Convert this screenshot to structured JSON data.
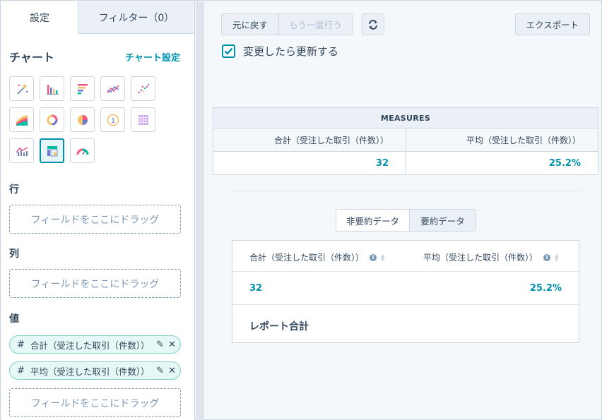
{
  "tabs": {
    "settings": "設定",
    "filters": "フィルター（0）"
  },
  "chart_section": {
    "title": "チャート",
    "settings_link": "チャート設定"
  },
  "chart_types": [
    "magic-wand-icon",
    "vertical-bar-chart-icon",
    "horizontal-bar-chart-icon",
    "line-chart-icon",
    "scatter-chart-icon",
    "area-chart-icon",
    "donut-chart-icon",
    "pie-chart-icon",
    "kpi-number-icon",
    "table-grid-icon",
    "combo-chart-icon",
    "pivot-table-icon",
    "gauge-chart-icon"
  ],
  "rows": {
    "label": "行",
    "dropzone": "フィールドをここにドラッグ"
  },
  "columns": {
    "label": "列",
    "dropzone": "フィールドをここにドラッグ"
  },
  "values": {
    "label": "値",
    "pills": [
      {
        "text": "合計（受注した取引（件数））"
      },
      {
        "text": "平均（受注した取引（件数））"
      }
    ],
    "dropzone": "フィールドをここにドラッグ"
  },
  "toolbar": {
    "undo": "元に戻す",
    "redo": "もう一度行う",
    "export": "エクスポート"
  },
  "auto_refresh": {
    "label": "変更したら更新する",
    "checked": true
  },
  "measures_table": {
    "header": "MEASURES",
    "columns": [
      "合計（受注した取引（件数））",
      "平均（受注した取引（件数））"
    ],
    "values": [
      "32",
      "25.2%"
    ]
  },
  "data_toggle": {
    "unsummarized": "非要約データ",
    "summarized": "要約データ"
  },
  "summary_table": {
    "columns": [
      "合計（受注した取引（件数））",
      "平均（受注した取引（件数））"
    ],
    "values": [
      "32",
      "25.2%"
    ],
    "total_label": "レポート合計"
  },
  "colors": {
    "accent": "#0091ae",
    "text": "#33475b",
    "border": "#cbd6e2"
  }
}
